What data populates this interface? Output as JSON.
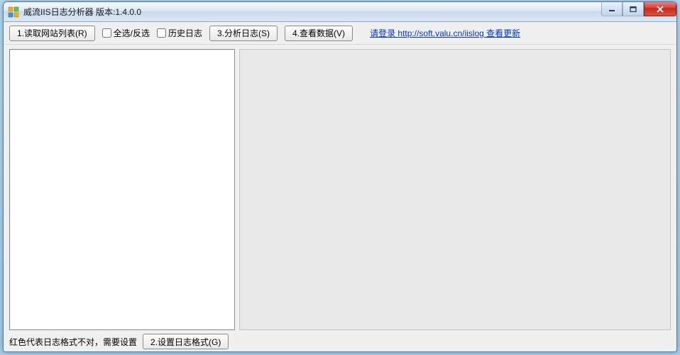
{
  "title": "威流IIS日志分析器 版本:1.4.0.0",
  "toolbar": {
    "read_sites_label": "1.读取网站列表(R)",
    "select_all_label": "全选/反选",
    "history_log_label": "历史日志",
    "analyze_label": "3.分析日志(S)",
    "view_data_label": "4.查看数据(V)",
    "login_link": "请登录 http://soft.valu.cn/iislog 查看更新"
  },
  "footer": {
    "hint": "红色代表日志格式不对，需要设置",
    "set_format_label": "2.设置日志格式(G)"
  }
}
